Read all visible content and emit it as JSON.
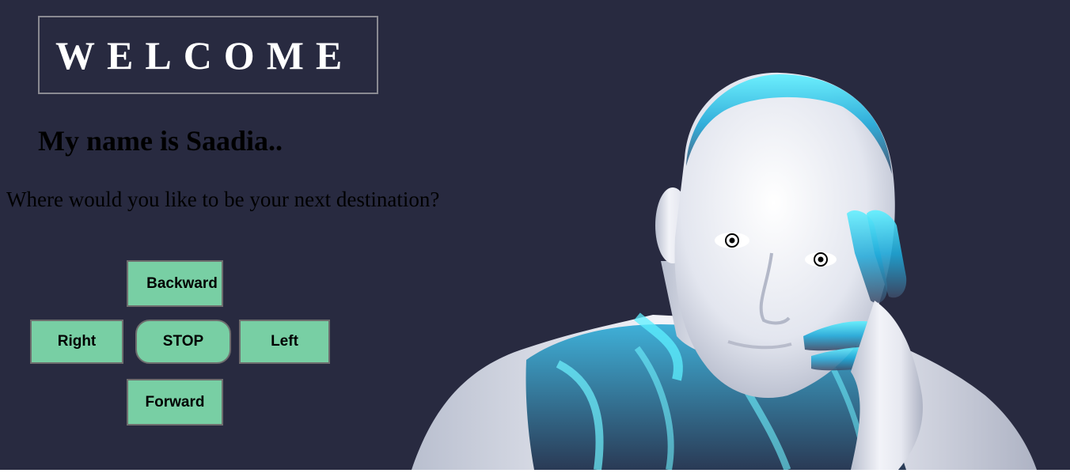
{
  "header": {
    "welcome": "WELCOME"
  },
  "intro": {
    "name_line": "My name is Saadia..",
    "question": "Where would you like to be your next destination?"
  },
  "controls": {
    "backward": "Backward",
    "right": "Right",
    "stop": "STOP",
    "left": "Left",
    "forward": "Forward"
  },
  "colors": {
    "background": "#282a40",
    "button": "#78cfa4",
    "accent_cyan": "#3fe3f4"
  },
  "illustration": {
    "subject": "robot-humanoid-thinking"
  }
}
